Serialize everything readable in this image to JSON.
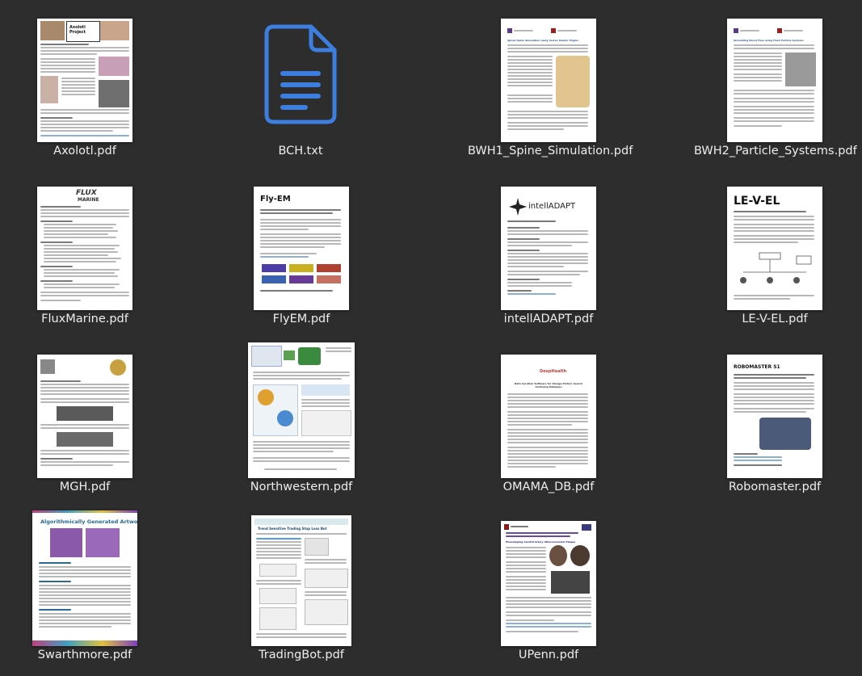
{
  "window": {
    "background": "#2d2d2d"
  },
  "files": [
    {
      "name": "Axolotl.pdf",
      "kind": "pdf"
    },
    {
      "name": "BCH.txt",
      "kind": "txt",
      "icon": "text-document-icon"
    },
    {
      "name": "BWH1_Spine_Simulation.pdf",
      "kind": "pdf"
    },
    {
      "name": "BWH2_Particle_Systems.pdf",
      "kind": "pdf"
    },
    {
      "name": "FluxMarine.pdf",
      "kind": "pdf"
    },
    {
      "name": "FlyEM.pdf",
      "kind": "pdf"
    },
    {
      "name": "intellADAPT.pdf",
      "kind": "pdf"
    },
    {
      "name": "LE-V-EL.pdf",
      "kind": "pdf"
    },
    {
      "name": "MGH.pdf",
      "kind": "pdf"
    },
    {
      "name": "Northwestern.pdf",
      "kind": "pdf"
    },
    {
      "name": "OMAMA_DB.pdf",
      "kind": "pdf"
    },
    {
      "name": "Robomaster.pdf",
      "kind": "pdf"
    },
    {
      "name": "Swarthmore.pdf",
      "kind": "pdf"
    },
    {
      "name": "TradingBot.pdf",
      "kind": "pdf"
    },
    {
      "name": "UPenn.pdf",
      "kind": "pdf"
    }
  ],
  "thumb_titles": {
    "axolotl": "Axolotl Project",
    "flux": "FLUX",
    "flux_sub": "MARINE",
    "flyem": "Fly-EM",
    "intell": "intellADAPT",
    "level": "LE-V-EL",
    "robomaster": "ROBOMASTER S1",
    "swarthmore": "Algorithmically Generated Artwork",
    "tradingbot": "Trend Sensitive Trading Stop Loss Bot",
    "upenn": "Phenotyping Carotid Artery Atherosclerotic Plaque",
    "omama": "Data Curation Software for Omaga Picture Search Archiving Database",
    "omama_logo": "DeepHealth",
    "bwh1": "Spinal Spine Simulation using Vertex Shader Engine",
    "bwh2": "Simulating Blood Flow using Fluid Particle Systems"
  },
  "colors": {
    "page": "#ffffff",
    "filename": "#ededed",
    "txt_blue": "#3d7fe0",
    "txt_blue_light": "#8ab8f5"
  }
}
